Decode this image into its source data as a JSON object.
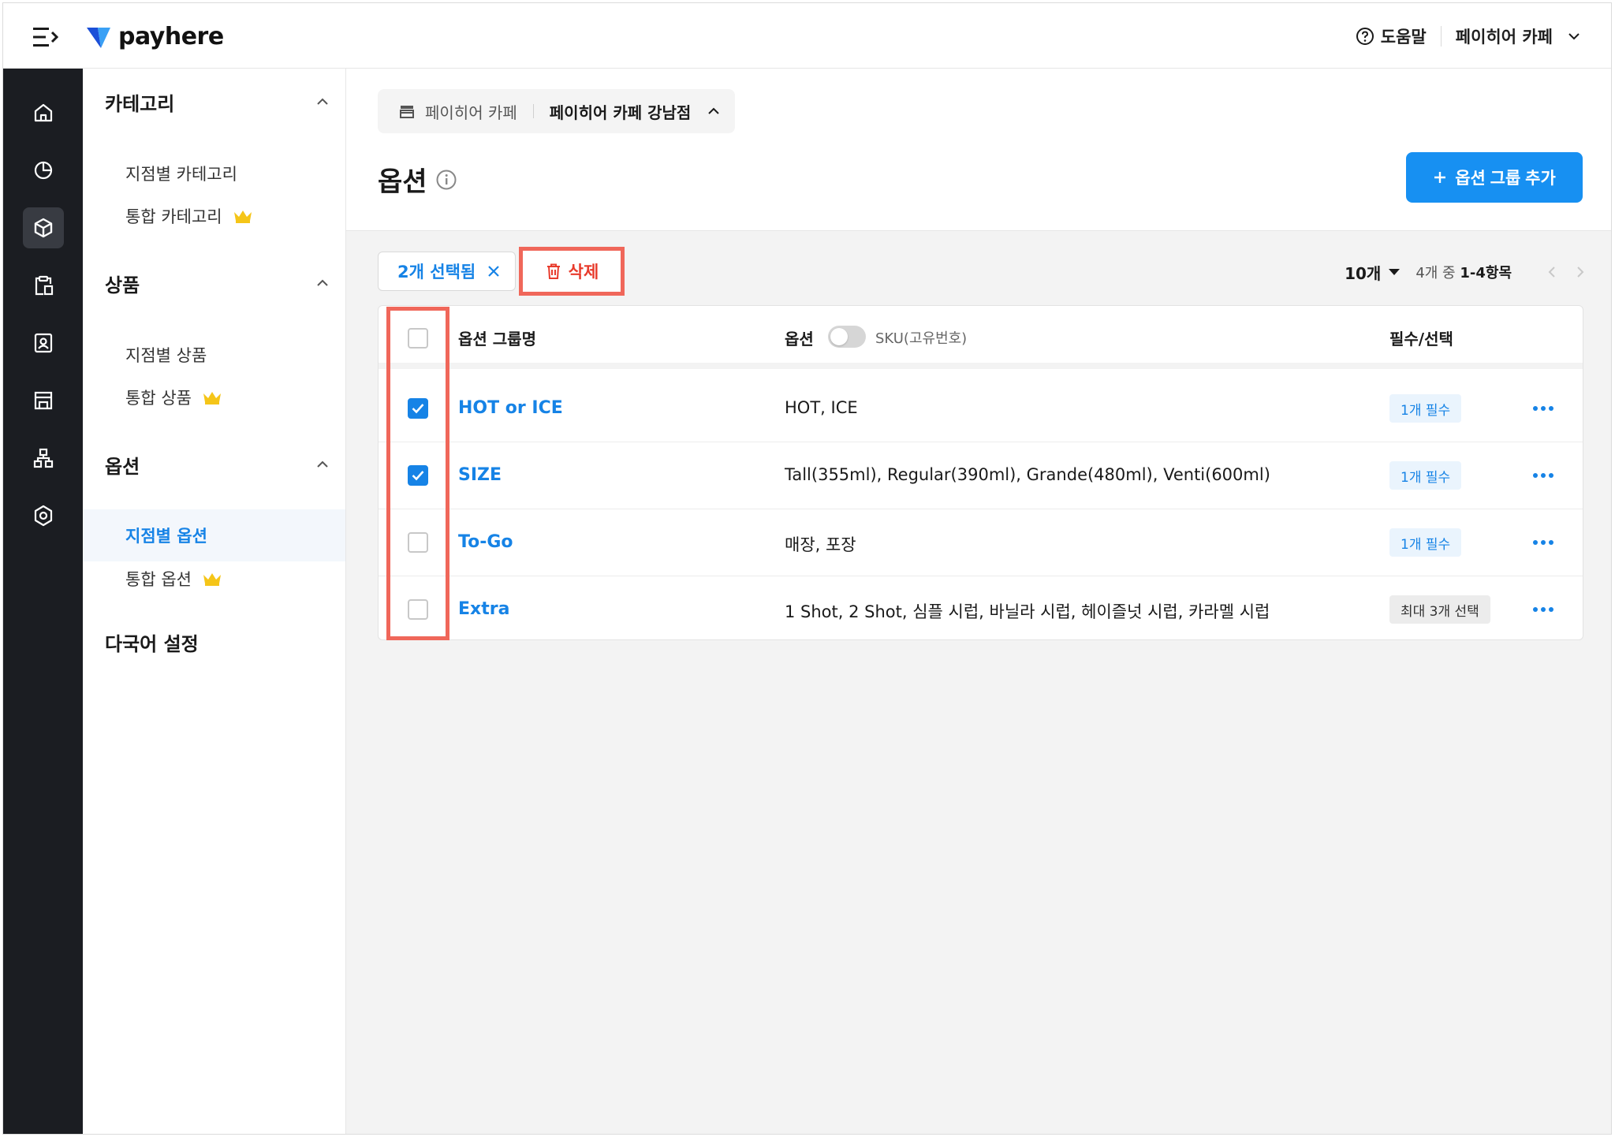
{
  "brand": {
    "name": "payhere",
    "accent": "#1683e6"
  },
  "topbar": {
    "help_label": "도움말",
    "store_name": "페이히어 카페"
  },
  "rail": {
    "items": [
      {
        "icon": "home-icon"
      },
      {
        "icon": "pie-chart-icon"
      },
      {
        "icon": "box-icon",
        "active": true
      },
      {
        "icon": "clipboard-icon"
      },
      {
        "icon": "contact-icon"
      },
      {
        "icon": "store-icon"
      },
      {
        "icon": "org-chart-icon"
      },
      {
        "icon": "settings-icon"
      }
    ]
  },
  "sidebar": {
    "sections": [
      {
        "title": "카테고리",
        "items": [
          {
            "label": "지점별 카테고리"
          },
          {
            "label": "통합 카테고리",
            "premium": true
          }
        ]
      },
      {
        "title": "상품",
        "items": [
          {
            "label": "지점별 상품"
          },
          {
            "label": "통합 상품",
            "premium": true
          }
        ]
      },
      {
        "title": "옵션",
        "items": [
          {
            "label": "지점별 옵션",
            "active": true
          },
          {
            "label": "통합 옵션",
            "premium": true
          }
        ]
      }
    ],
    "language_setting": "다국어 설정"
  },
  "breadcrumb": {
    "store": "페이히어 카페",
    "branch": "페이히어 카페 강남점"
  },
  "page": {
    "title": "옵션",
    "add_button": "옵션 그룹 추가"
  },
  "selection": {
    "label": "2개 선택됨",
    "delete_label": "삭제"
  },
  "pager": {
    "page_size": "10개",
    "range_prefix": "4개 중",
    "range": "1-4항목"
  },
  "table": {
    "headers": {
      "group_name": "옵션 그룹명",
      "options": "옵션",
      "sku_label": "SKU(고유번호)",
      "required": "필수/선택"
    },
    "rows": [
      {
        "checked": true,
        "name": "HOT or ICE",
        "options": "HOT, ICE",
        "badge": "1개 필수",
        "badge_type": "req"
      },
      {
        "checked": true,
        "name": "SIZE",
        "options": "Tall(355ml), Regular(390ml), Grande(480ml), Venti(600ml)",
        "badge": "1개 필수",
        "badge_type": "req"
      },
      {
        "checked": false,
        "name": "To-Go",
        "options": "매장, 포장",
        "badge": "1개 필수",
        "badge_type": "req"
      },
      {
        "checked": false,
        "name": "Extra",
        "options": "1 Shot, 2 Shot, 심플 시럽, 바닐라 시럽, 헤이즐넛 시럽, 카라멜 시럽",
        "badge": "최대 3개 선택",
        "badge_type": "max"
      }
    ]
  }
}
